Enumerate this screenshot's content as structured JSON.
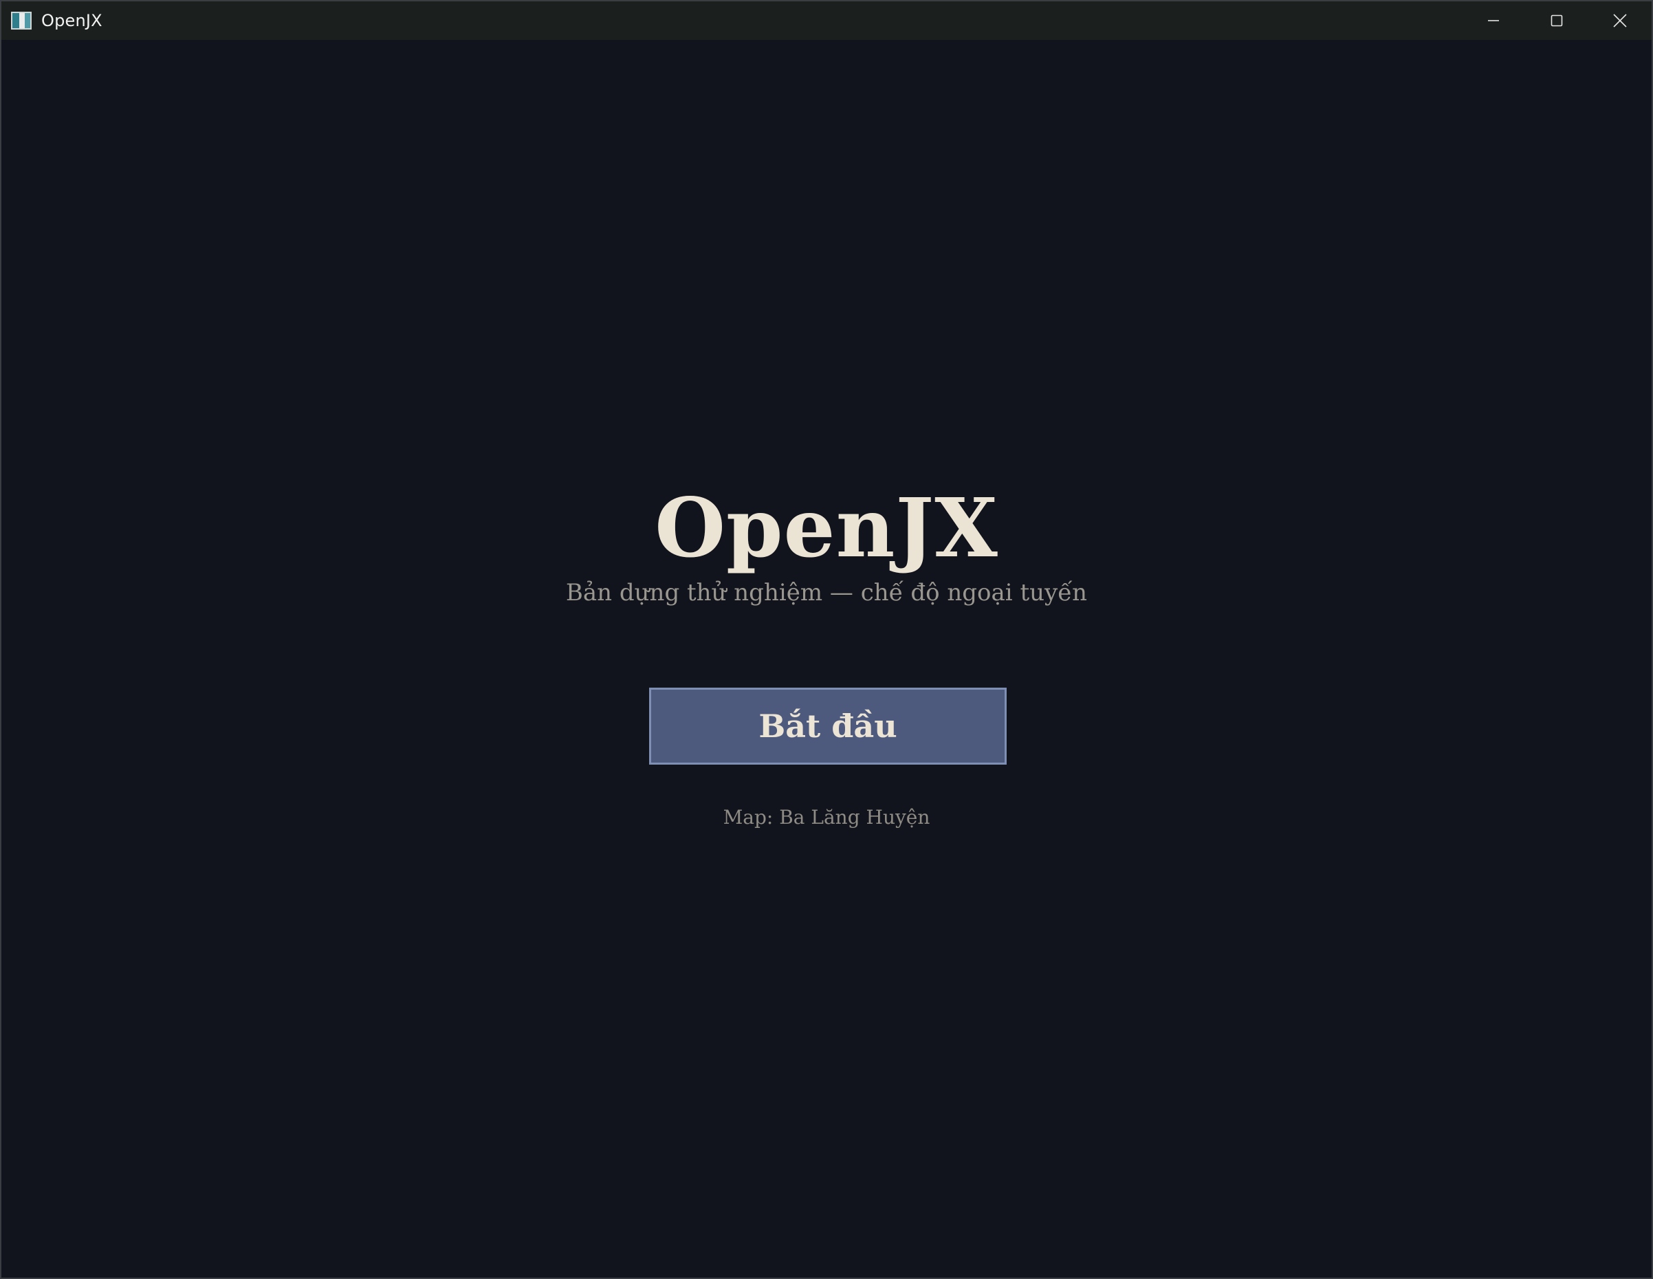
{
  "window": {
    "title": "OpenJX"
  },
  "window_controls": {
    "minimize": "minimize-icon",
    "maximize": "maximize-icon",
    "close": "close-icon"
  },
  "menu": {
    "game_title": "OpenJX",
    "subtitle": "Bản dựng thử nghiệm — chế độ ngoại tuyến",
    "start_label": "Bắt đầu",
    "map_text": "Map: Ba Lăng Huyện"
  },
  "colors": {
    "background": "#11141c",
    "title_text": "#ebe3d4",
    "button_fill": "#4d5a7e",
    "button_border": "#7f8fb3"
  }
}
